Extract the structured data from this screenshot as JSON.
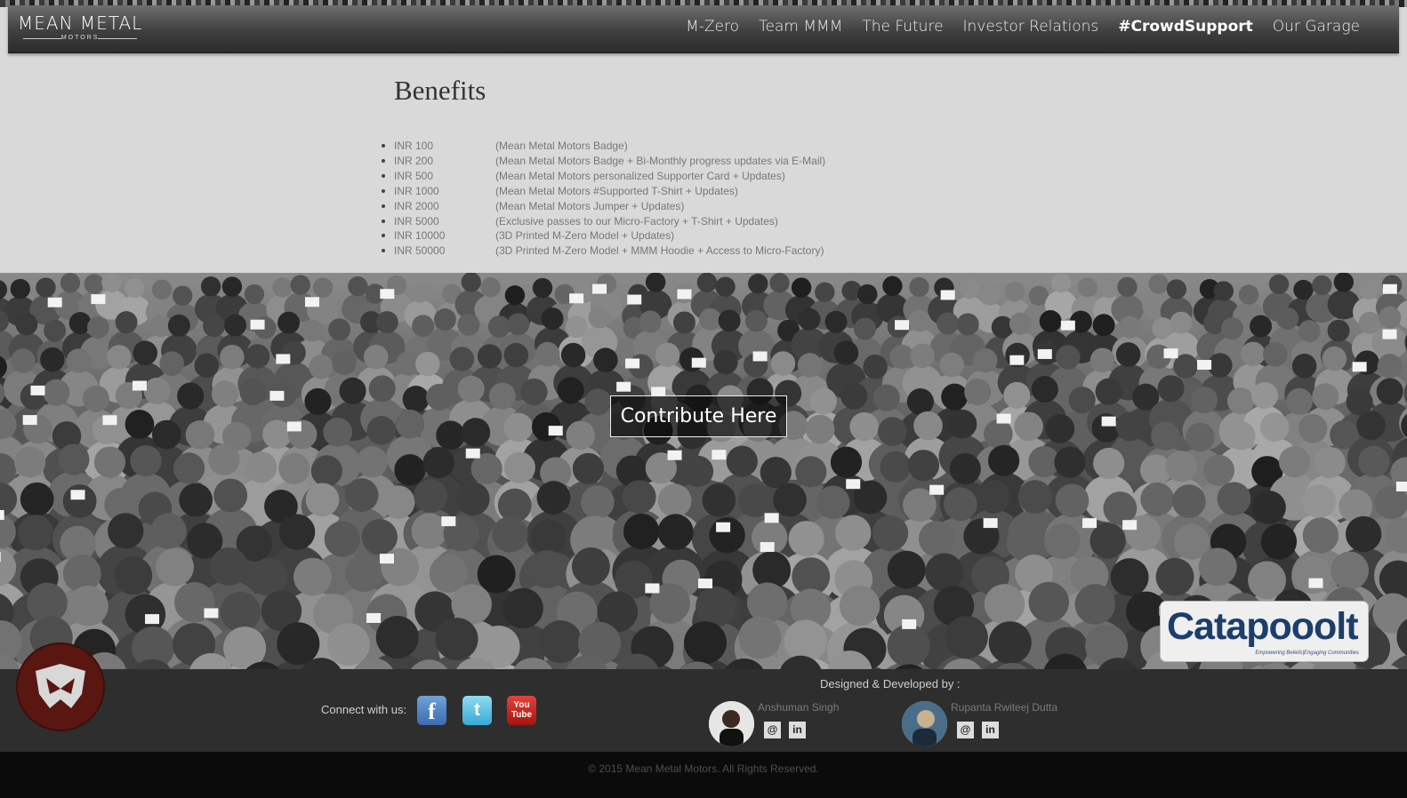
{
  "header": {
    "logo_main": "MEAN METAL",
    "logo_sub": "MOTORS",
    "nav": [
      {
        "label": "M-Zero"
      },
      {
        "label": "Team MMM"
      },
      {
        "label": "The Future"
      },
      {
        "label": "Investor Relations"
      },
      {
        "label": "#CrowdSupport",
        "active": true
      },
      {
        "label": "Our Garage"
      }
    ]
  },
  "benefits": {
    "title": "Benefits",
    "items": [
      {
        "amount": "INR 100",
        "desc": "(Mean Metal Motors Badge)"
      },
      {
        "amount": "INR 200",
        "desc": "(Mean Metal Motors Badge + Bi-Monthly progress updates via E-Mail)"
      },
      {
        "amount": "INR 500",
        "desc": "(Mean Metal Motors personalized Supporter Card + Updates)"
      },
      {
        "amount": "INR 1000",
        "desc": "(Mean Metal Motors #Supported T-Shirt + Updates)"
      },
      {
        "amount": "INR 2000",
        "desc": "(Mean Metal Motors Jumper + Updates)"
      },
      {
        "amount": "INR 5000",
        "desc": "(Exclusive passes to our Micro-Factory + T-Shirt + Updates)"
      },
      {
        "amount": "INR 10000",
        "desc": "(3D Printed M-Zero Model + Updates)"
      },
      {
        "amount": "INR 50000",
        "desc": "(3D Printed M-Zero Model + MMM Hoodie + Access to Micro-Factory)"
      }
    ]
  },
  "hero": {
    "cta_label": "Contribute Here",
    "partner_logo": "Catapooolt",
    "partner_tagline": "Empowering Beliefs|Engaging Communities"
  },
  "footer": {
    "connect_label": "Connect with us:",
    "social": [
      {
        "icon": "facebook-icon",
        "glyph": "f"
      },
      {
        "icon": "twitter-icon",
        "glyph": "t"
      },
      {
        "icon": "youtube-icon",
        "glyph": "You Tube"
      }
    ],
    "designed_label": "Designed & Developed by :",
    "developers": [
      {
        "name": "Anshuman Singh",
        "email_glyph": "@",
        "linkedin_glyph": "in"
      },
      {
        "name": "Rupanta Rwiteej Dutta",
        "email_glyph": "@",
        "linkedin_glyph": "in"
      }
    ],
    "copyright": "© 2015 Mean Metal Motors. All Rights Reserved."
  },
  "colors": {
    "page_bg": "#d9d9d9",
    "footer_bg": "#2e2e2e",
    "copyright_bg": "#0b0b0b",
    "badge_bg": "#5a1712",
    "catapooolt_blue": "#1c3e6b"
  }
}
